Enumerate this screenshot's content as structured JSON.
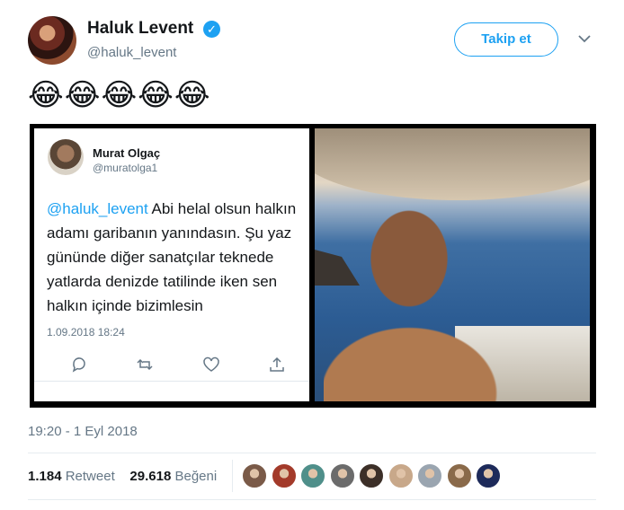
{
  "tweet": {
    "display_name": "Haluk Levent",
    "handle": "@haluk_levent",
    "follow_label": "Takip et",
    "text": "😂😂😂😂😂",
    "timestamp": "19:20 - 1 Eyl 2018",
    "retweet_count": "1.184",
    "retweet_label": "Retweet",
    "like_count": "29.618",
    "like_label": "Beğeni"
  },
  "quoted": {
    "name": "Murat Olgaç",
    "handle": "@muratolga1",
    "mention": "@haluk_levent",
    "text": " Abi helal olsun halkın adamı garibanın yanındasın. Şu yaz gününde diğer sanatçılar teknede yatlarda denizde tatilinde iken sen halkın içinde bizimlesin",
    "time": "1.09.2018 18:24"
  },
  "colors": {
    "accent": "#1da1f2",
    "secondary_text": "#657786"
  },
  "icons": [
    "verified-icon",
    "chevron-down-icon",
    "reply-icon",
    "retweet-icon",
    "like-icon",
    "share-icon"
  ],
  "likers": [
    {
      "color": "#7a5a48"
    },
    {
      "color": "#a33a2a"
    },
    {
      "color": "#4f8f8a"
    },
    {
      "color": "#6b6b6b"
    },
    {
      "color": "#3c2f28"
    },
    {
      "color": "#c8a88a"
    },
    {
      "color": "#9aa5b0"
    },
    {
      "color": "#8a6a4a"
    },
    {
      "color": "#1d2a5a"
    }
  ]
}
